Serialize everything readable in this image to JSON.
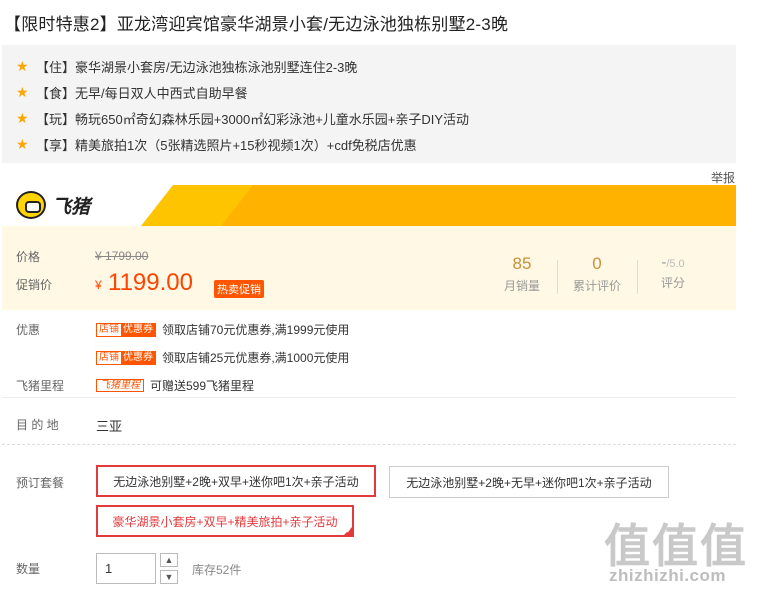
{
  "title": "【限时特惠2】亚龙湾迎宾馆豪华湖景小套/无边泳池独栋别墅2-3晚",
  "features": [
    {
      "icon": "star-icon",
      "text": "【住】豪华湖景小套房/无边泳池独栋泳池别墅连住2-3晚"
    },
    {
      "icon": "star-icon",
      "text": "【食】无早/每日双人中西式自助早餐"
    },
    {
      "icon": "star-icon",
      "text": "【玩】畅玩650㎡奇幻森林乐园+3000㎡幻彩泳池+儿童水乐园+亲子DIY活动"
    },
    {
      "icon": "star-icon",
      "text": "【享】精美旅拍1次（5张精选照片+15秒视频1次）+cdf免税店优惠"
    }
  ],
  "report_link": "举报",
  "brand": {
    "name": "飞猪",
    "logo_icon": "fliggy-logo-icon",
    "bar_color": "#ffd400",
    "accent_color": "#ffb300"
  },
  "price": {
    "label": "价格",
    "original": "¥ 1799.00",
    "promo_label": "促销价",
    "currency": "¥",
    "current": "1199.00",
    "hot_tag": "热卖促销",
    "price_color": "#ff4400"
  },
  "stats": [
    {
      "value": "85",
      "caption": "月销量"
    },
    {
      "value": "0",
      "caption": "累计评价"
    },
    {
      "value": "-",
      "suffix": "/5.0",
      "caption": "评分"
    }
  ],
  "coupons": {
    "label": "优惠",
    "items": [
      {
        "tag_a": "店铺",
        "tag_b": "优惠券",
        "text": "领取店铺70元优惠券,满1999元使用"
      },
      {
        "tag_a": "店铺",
        "tag_b": "优惠券",
        "text": "领取店铺25元优惠券,满1000元使用"
      }
    ]
  },
  "mileage": {
    "label": "飞猪里程",
    "tag": "飞猪里程",
    "text": "可赠送599飞猪里程"
  },
  "destination": {
    "label": "目 的 地",
    "value": "三亚"
  },
  "packages": {
    "label": "预订套餐",
    "options": [
      {
        "text": "无边泳池别墅+2晚+双早+迷你吧1次+亲子活动",
        "selected": true
      },
      {
        "text": "无边泳池别墅+2晚+无早+迷你吧1次+亲子活动",
        "selected": false
      },
      {
        "text": "豪华湖景小套房+双早+精美旅拍+亲子活动",
        "selected": true
      }
    ],
    "selected_color": "#e4393c"
  },
  "quantity": {
    "label": "数量",
    "value": "1",
    "up_icon": "chevron-up-icon",
    "down_icon": "chevron-down-icon",
    "stock": "库存52件"
  },
  "watermark": {
    "glyphs": [
      "值",
      "值",
      "值"
    ],
    "url": "zhizhizhi.com"
  }
}
